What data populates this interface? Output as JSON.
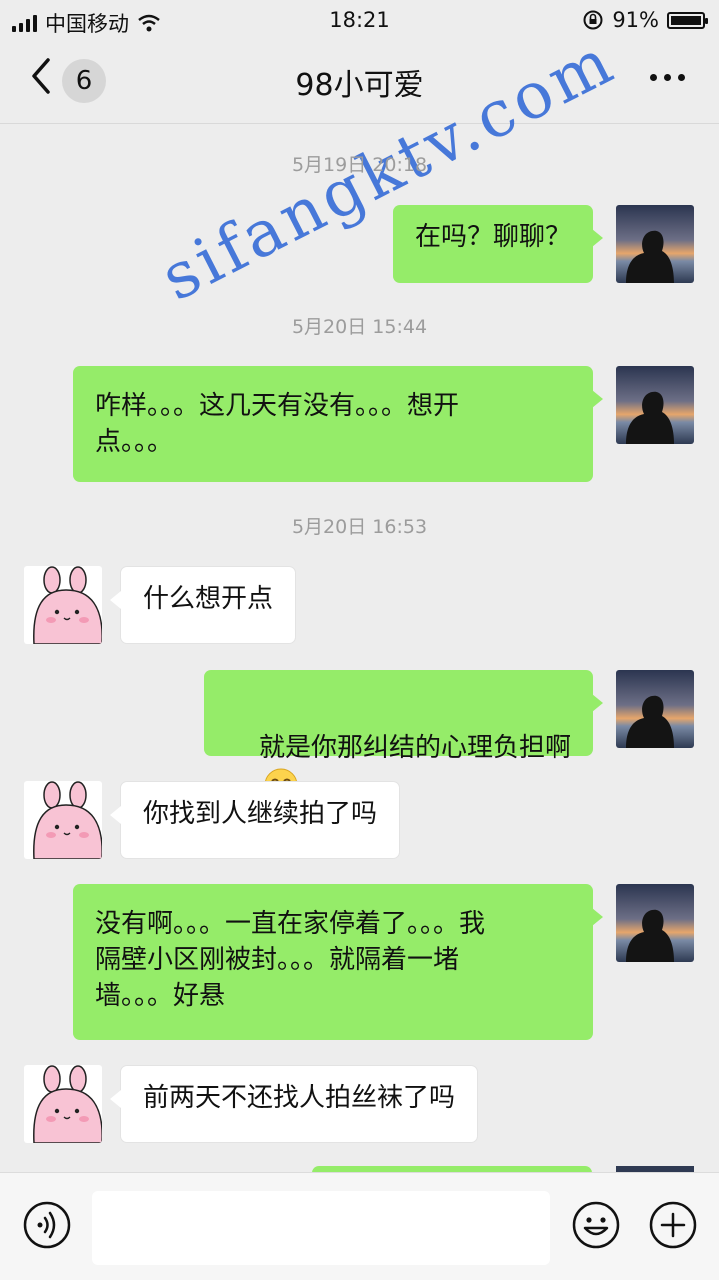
{
  "status_bar": {
    "carrier": "中国移动",
    "time": "18:21",
    "battery": "91%"
  },
  "header": {
    "unread_count": "6",
    "title": "98小可爱"
  },
  "watermark": "sifangktv.com",
  "messages": [
    {
      "type": "timestamp",
      "text": "5月19日 20:18"
    },
    {
      "type": "sent",
      "text": "在吗？聊聊？"
    },
    {
      "type": "timestamp",
      "text": "5月20日 15:44"
    },
    {
      "type": "sent",
      "text": "咋样。。。这几天有没有。。。想开\n点。。。"
    },
    {
      "type": "timestamp",
      "text": "5月20日 16:53"
    },
    {
      "type": "received",
      "text": "什么想开点"
    },
    {
      "type": "sent",
      "text": "就是你那纠结的心理负担啊",
      "emoji": "shushing-face-emoji"
    },
    {
      "type": "received",
      "text": "你找到人继续拍了吗"
    },
    {
      "type": "sent",
      "text": "没有啊。。。一直在家停着了。。。我\n隔壁小区刚被封。。。就隔着一堵\n墙。。。好悬"
    },
    {
      "type": "received",
      "text": "前两天不还找人拍丝袜了吗"
    }
  ],
  "toolbar": {
    "icons": [
      "voice-icon",
      "emoji-icon",
      "plus-icon"
    ]
  },
  "colors": {
    "sent_bubble": "#95ec69",
    "received_bubble": "#ffffff",
    "background": "#ededed"
  }
}
